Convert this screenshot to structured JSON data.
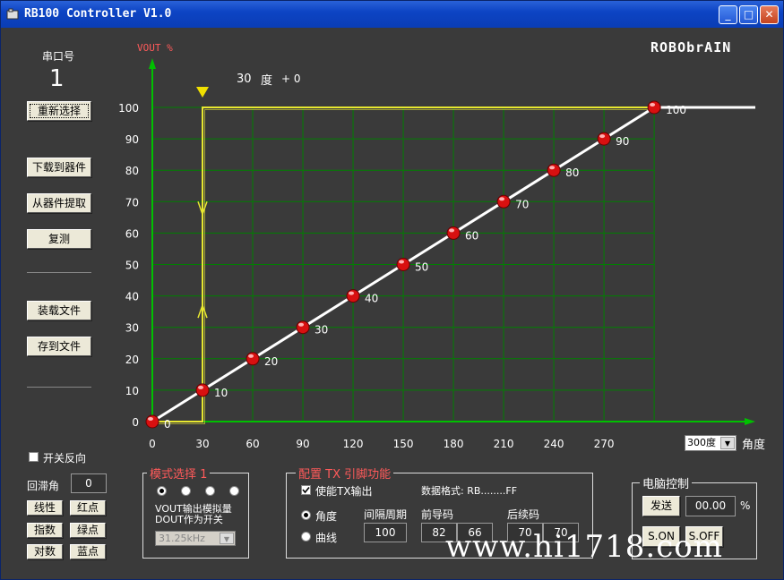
{
  "window": {
    "title": "RB100 Controller V1.0",
    "minimize": "_",
    "maximize": "□",
    "close": "✕"
  },
  "brand": {
    "logo": "ROBObrAIN"
  },
  "left_panel": {
    "port_label": "串口号",
    "port_value": "1",
    "reselect": "重新选择",
    "download": "下载到器件",
    "read_from": "从器件提取",
    "reset": "复测",
    "load_file": "装载文件",
    "save_file": "存到文件",
    "invert_label": "开关反向",
    "hysteresis_label": "回滞角",
    "hysteresis_value": "0",
    "linear": "线性",
    "red_point": "红点",
    "exponential": "指数",
    "green_point": "绿点",
    "logarithmic": "对数",
    "blue_point": "蓝点"
  },
  "chart_header": {
    "marker_value": "30",
    "marker_unit": "度",
    "marker_offset": "+ 0"
  },
  "chart_data": {
    "type": "line",
    "ylabel": "VOUT %",
    "xlabel": "角度",
    "xlim": [
      0,
      300
    ],
    "ylim": [
      0,
      100
    ],
    "x_ticks": [
      0,
      30,
      60,
      90,
      120,
      150,
      180,
      210,
      240,
      270
    ],
    "y_ticks": [
      0,
      10,
      20,
      30,
      40,
      50,
      60,
      70,
      80,
      90,
      100
    ],
    "grid": true,
    "series": [
      {
        "x": [
          0,
          30,
          60,
          90,
          120,
          150,
          180,
          210,
          240,
          270,
          300
        ],
        "values": [
          0,
          10,
          20,
          30,
          40,
          50,
          60,
          70,
          80,
          90,
          100
        ],
        "point_labels": [
          "0",
          "10",
          "20",
          "30",
          "40",
          "50",
          "60",
          "70",
          "80",
          "90",
          "100"
        ],
        "color": "#ffffff",
        "point_color": "#d81010"
      },
      {
        "x": [
          0,
          30,
          30,
          300
        ],
        "values": [
          0,
          0,
          100,
          100
        ],
        "color": "#e8e830"
      }
    ],
    "threshold_x": 30,
    "colors": {
      "background": "#3a3a3a",
      "grid": "#008000",
      "axes": "#00c000",
      "marker": "#f0e000"
    }
  },
  "angle_select": {
    "value": "300度",
    "label": "角度"
  },
  "mode_group": {
    "title": "模式选择",
    "title_value": "1",
    "radios": [
      true,
      false,
      false,
      false
    ],
    "desc_line1": "VOUT输出模拟量",
    "desc_line2": "DOUT作为开关",
    "freq": "31.25kHz"
  },
  "config_group": {
    "title": "配置 TX 引脚功能",
    "enable_tx": "使能TX输出",
    "data_format": "数据格式: RB........FF",
    "angle": "角度",
    "curve": "曲线",
    "interval_label": "间隔周期",
    "interval_value": "100",
    "prefix_label": "前导码",
    "prefix_1": "82",
    "prefix_2": "66",
    "suffix_label": "后续码",
    "suffix_1": "70",
    "suffix_2": "70"
  },
  "pc_group": {
    "title": "电脑控制",
    "send": "发送",
    "percent_value": "00.00",
    "percent_unit": "%",
    "s_on": "S.ON",
    "s_off": "S.OFF"
  },
  "watermark": "www.hi1718.com"
}
